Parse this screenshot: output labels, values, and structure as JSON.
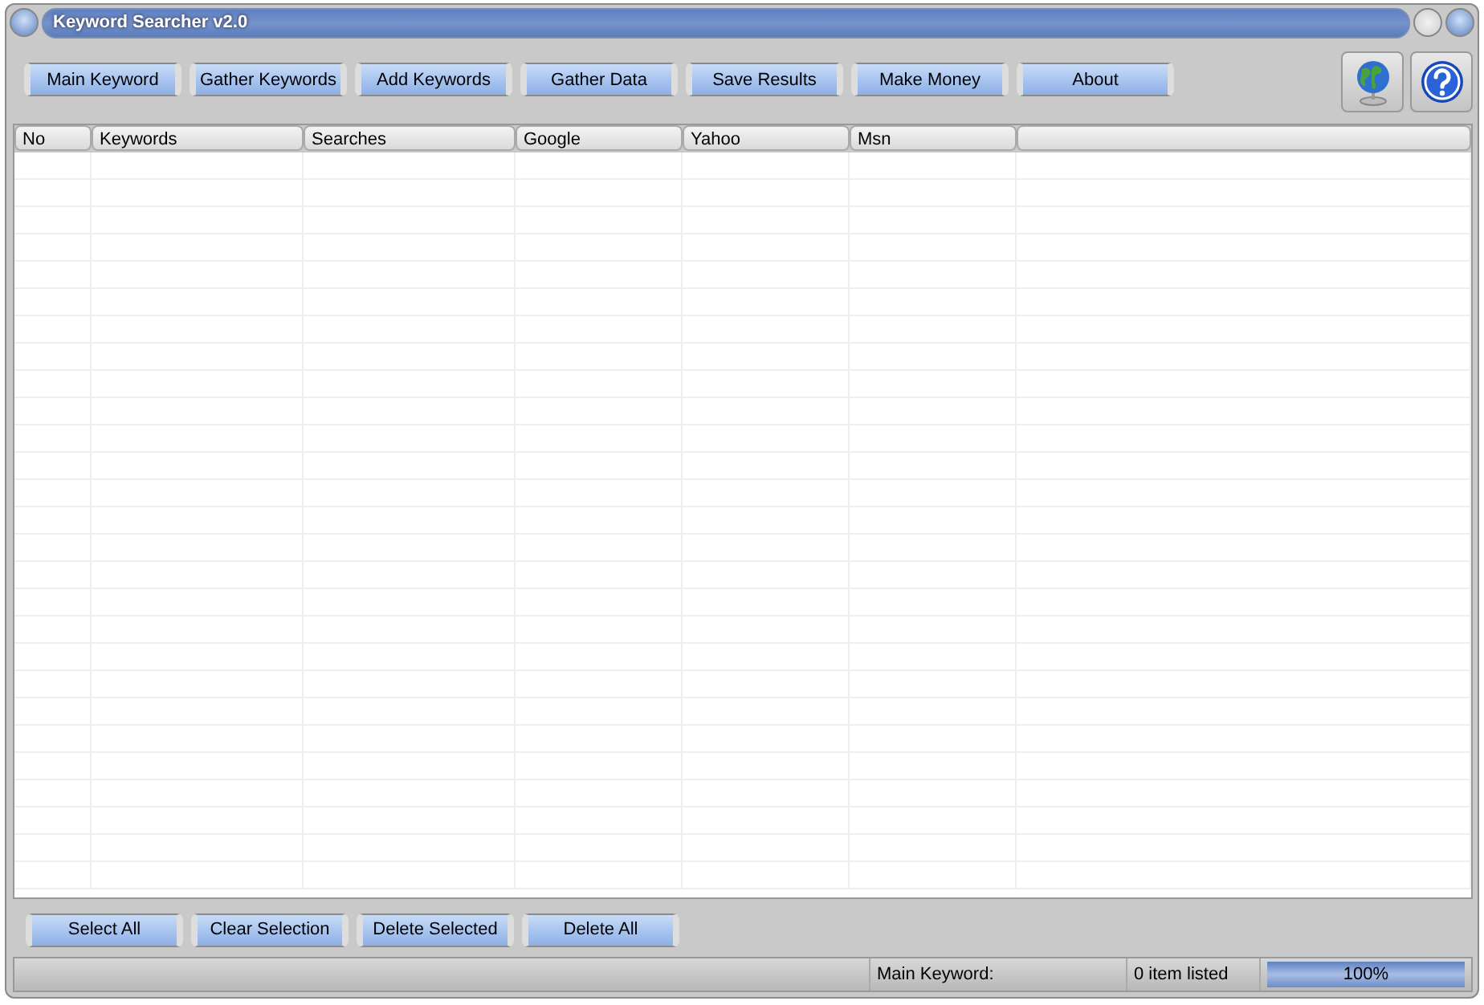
{
  "window": {
    "title": "Keyword Searcher v2.0"
  },
  "toolbar": [
    "Main Keyword",
    "Gather Keywords",
    "Add Keywords",
    "Gather Data",
    "Save Results",
    "Make Money",
    "About"
  ],
  "table": {
    "columns": [
      "No",
      "Keywords",
      "Searches",
      "Google",
      "Yahoo",
      "Msn"
    ]
  },
  "actions": [
    "Select All",
    "Clear Selection",
    "Delete Selected",
    "Delete All"
  ],
  "status_bar": {
    "label": "Main Keyword:",
    "count": "0 item listed",
    "progress": {
      "level": 1,
      "reading": "100%"
    }
  }
}
